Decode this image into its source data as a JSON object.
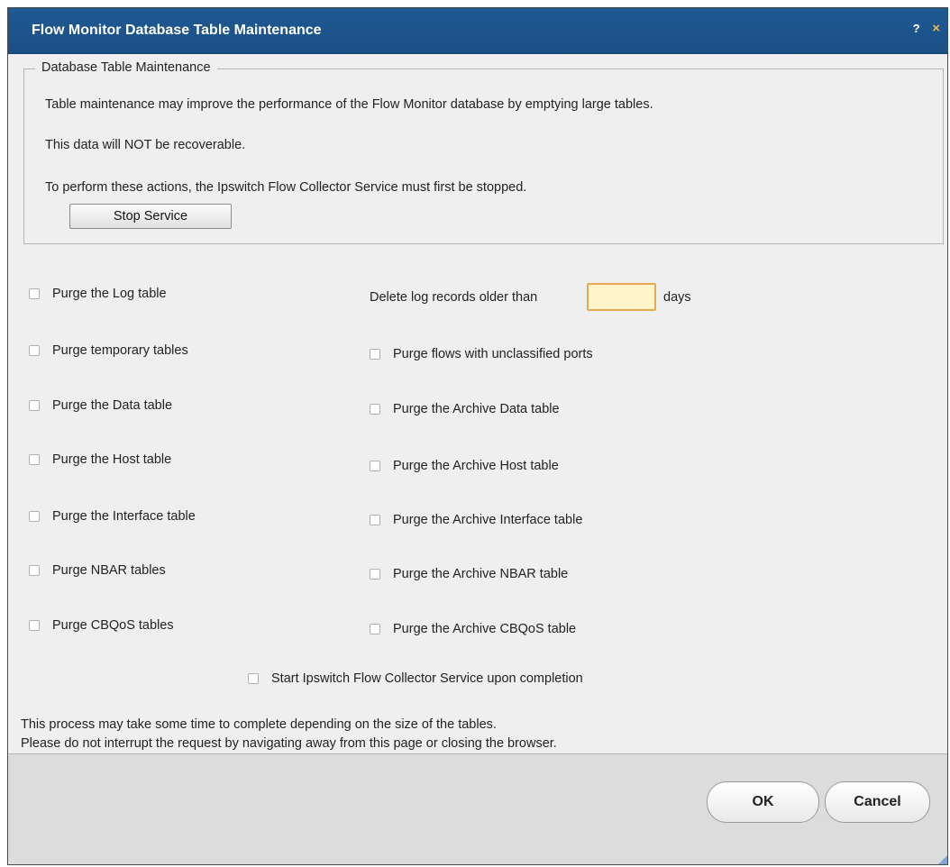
{
  "window": {
    "title": "Flow Monitor Database Table Maintenance",
    "help_glyph": "?",
    "close_glyph": "×"
  },
  "maintenance": {
    "legend": "Database Table Maintenance",
    "line1": "Table maintenance may improve the performance of the Flow Monitor database by emptying large tables.",
    "line2": "This data will NOT be recoverable.",
    "line3": "To perform these actions, the Ipswitch Flow Collector Service must first be stopped.",
    "stop_button": "Stop Service"
  },
  "left_options": [
    {
      "label": "Purge the Log table",
      "checked": false
    },
    {
      "label": "Purge temporary tables",
      "checked": false
    },
    {
      "label": "Purge the Data table",
      "checked": false
    },
    {
      "label": "Purge the Host table",
      "checked": false
    },
    {
      "label": "Purge the Interface table",
      "checked": false
    },
    {
      "label": "Purge NBAR tables",
      "checked": false
    },
    {
      "label": "Purge CBQoS tables",
      "checked": false
    }
  ],
  "log_days": {
    "label": "Delete log records older than",
    "value": "",
    "unit": "days"
  },
  "right_options": [
    {
      "label": "Purge flows with unclassified ports",
      "checked": false
    },
    {
      "label": "Purge the Archive Data table",
      "checked": false
    },
    {
      "label": "Purge the Archive Host table",
      "checked": false
    },
    {
      "label": "Purge the Archive Interface table",
      "checked": false
    },
    {
      "label": "Purge the Archive NBAR table",
      "checked": false
    },
    {
      "label": "Purge the Archive CBQoS table",
      "checked": false
    }
  ],
  "start_service_option": {
    "label": "Start Ipswitch Flow Collector Service upon completion",
    "checked": false
  },
  "notes": {
    "line1": "This process may take some time to complete depending on the size of the tables.",
    "line2": "Please do not interrupt the request by navigating away from this page or closing the browser."
  },
  "footer": {
    "ok_label": "OK",
    "cancel_label": "Cancel"
  },
  "colors": {
    "titlebar": "#1d5690",
    "days_input_border": "#e6ab52",
    "days_input_fill": "#fff6cc"
  }
}
